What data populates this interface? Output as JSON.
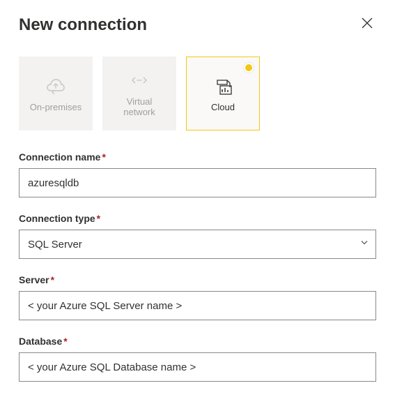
{
  "header": {
    "title": "New connection"
  },
  "tabs": [
    {
      "id": "onprem",
      "label": "On-premises"
    },
    {
      "id": "vnet",
      "label": "Virtual\nnetwork"
    },
    {
      "id": "cloud",
      "label": "Cloud"
    }
  ],
  "form": {
    "connection_name": {
      "label": "Connection name",
      "value": "azuresqldb"
    },
    "connection_type": {
      "label": "Connection type",
      "value": "SQL Server"
    },
    "server": {
      "label": "Server",
      "value": "< your Azure SQL Server name >"
    },
    "database": {
      "label": "Database",
      "value": "< your Azure SQL Database name >"
    }
  }
}
